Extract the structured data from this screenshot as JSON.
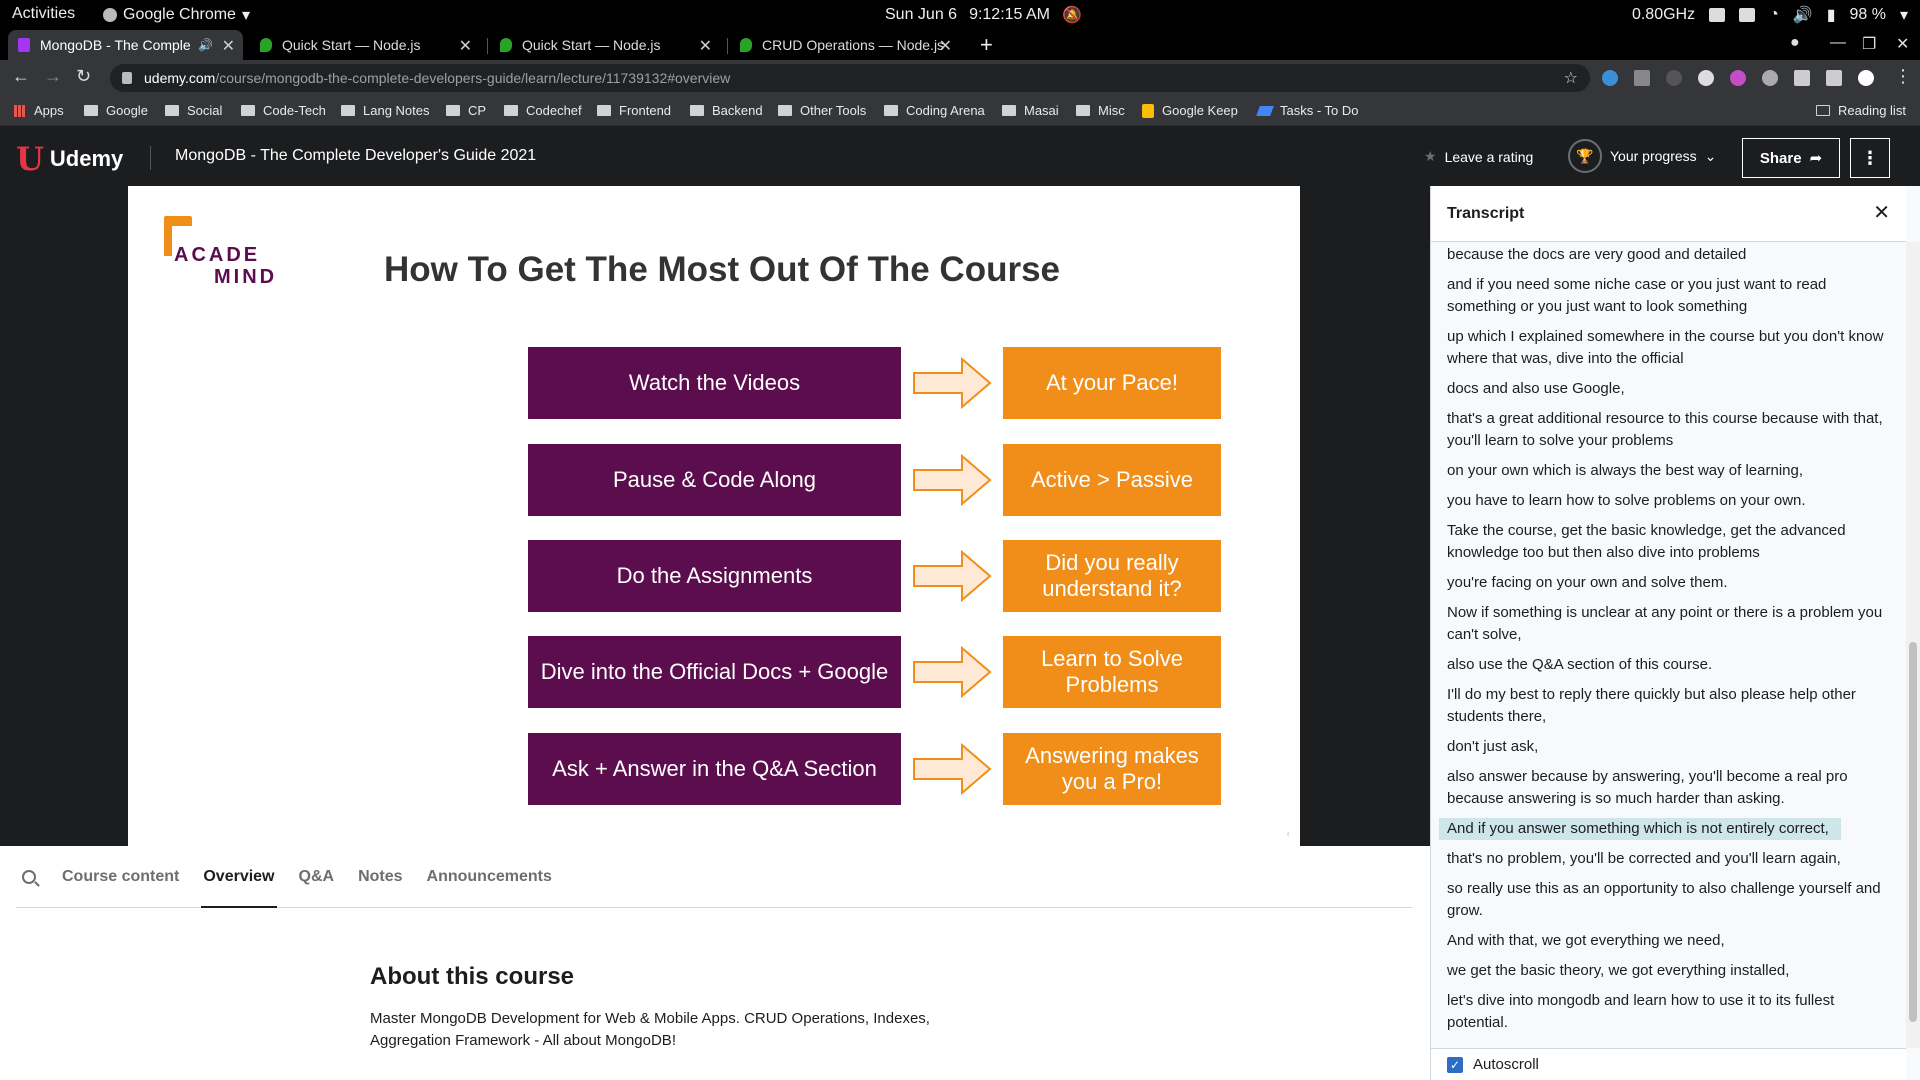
{
  "os_bar": {
    "activities": "Activities",
    "app_name": "Google Chrome",
    "date": "Sun Jun 6",
    "time": "9:12:15 AM",
    "cpu": "0.80GHz",
    "battery": "98 %"
  },
  "browser": {
    "tabs": [
      {
        "title": "MongoDB - The Complete",
        "active": true
      },
      {
        "title": "Quick Start — Node.js",
        "active": false
      },
      {
        "title": "Quick Start — Node.js",
        "active": false
      },
      {
        "title": "CRUD Operations — Node.js",
        "active": false
      }
    ],
    "url_host": "udemy.com",
    "url_path": "/course/mongodb-the-complete-developers-guide/learn/lecture/11739132#overview",
    "bookmarks": [
      "Apps",
      "Google",
      "Social",
      "Code-Tech",
      "Lang Notes",
      "CP",
      "Codechef",
      "Frontend",
      "Backend",
      "Other Tools",
      "Coding Arena",
      "Masai",
      "Misc",
      "Google Keep",
      "Tasks - To Do"
    ],
    "reading_list": "Reading list"
  },
  "header": {
    "logo_text": "Udemy",
    "course_title": "MongoDB - The Complete Developer's Guide 2021",
    "leave_rating": "Leave a rating",
    "your_progress": "Your progress",
    "share": "Share"
  },
  "slide": {
    "logo_line1": "ACADE",
    "logo_line2": "MIND",
    "title": "How To Get The Most Out Of The Course",
    "rows": [
      {
        "left": "Watch the Videos",
        "right": "At your Pace!"
      },
      {
        "left": "Pause & Code Along",
        "right": "Active > Passive"
      },
      {
        "left": "Do the Assignments",
        "right": "Did you really understand it?"
      },
      {
        "left": "Dive into the Official Docs + Google",
        "right": "Learn to Solve Problems"
      },
      {
        "left": "Ask + Answer in the Q&A Section",
        "right": "Answering makes you a Pro!"
      }
    ]
  },
  "course_tabs": [
    "Course content",
    "Overview",
    "Q&A",
    "Notes",
    "Announcements"
  ],
  "about": {
    "title": "About this course",
    "text": "Master MongoDB Development for Web & Mobile Apps. CRUD Operations, Indexes, Aggregation Framework - All about MongoDB!"
  },
  "transcript": {
    "title": "Transcript",
    "lines": [
      "because the docs are very good and detailed",
      "and if you need some niche case or you just want to read something or you just want to look something",
      "up which I explained somewhere in the course but you don't know where that was, dive into the official",
      "docs and also use Google,",
      "that's a great additional resource to this course because with that, you'll learn to solve your problems",
      "on your own which is always the best way of learning,",
      "you have to learn how to solve problems on your own.",
      "Take the course, get the basic knowledge, get the advanced knowledge too but then also dive into problems",
      "you're facing on your own and solve them.",
      "Now if something is unclear at any point or there is a problem you can't solve,",
      "also use the Q&A section of this course.",
      "I'll do my best to reply there quickly but also please help other students there,",
      "don't just ask,",
      "also answer because by answering, you'll become a real pro because answering is so much harder than asking.",
      "And if you answer something which is not entirely correct,",
      "that's no problem, you'll be corrected and you'll learn again,",
      "so really use this as an opportunity to also challenge yourself and grow.",
      "And with that, we got everything we need,",
      "we get the basic theory, we got everything installed,",
      "let's dive into mongodb and learn how to use it to its fullest potential."
    ],
    "highlighted_index": 14,
    "autoscroll_label": "Autoscroll"
  }
}
